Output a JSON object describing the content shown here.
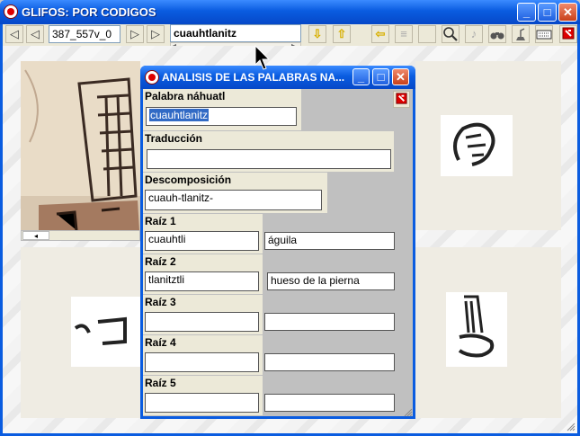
{
  "main_window": {
    "title": "GLIFOS: POR CODIGOS",
    "minimize": "_",
    "maximize": "□",
    "close": "✕"
  },
  "toolbar": {
    "code_field": "387_557v_0",
    "search_field": "cuauhtlanitz",
    "scroll_left": "◂",
    "scroll_right": "▸",
    "down_arrow": "⇩",
    "up_arrow": "⇧",
    "back_arrow": "⇦"
  },
  "panel_scroll_left": "◂",
  "dialog": {
    "title": "ANALISIS DE LAS PALABRAS NA...",
    "minimize": "_",
    "maximize": "□",
    "close": "✕",
    "palabra_label": "Palabra náhuatl",
    "palabra_value": "cuauhtlanitz",
    "traduccion_label": "Traducción",
    "traduccion_value": "",
    "descomposicion_label": "Descomposición",
    "descomposicion_value": "cuauh-tlanitz-",
    "roots": [
      {
        "label": "Raíz 1",
        "root": "cuauhtli",
        "meaning": "águila"
      },
      {
        "label": "Raíz 2",
        "root": "tlanitztli",
        "meaning": "hueso de la pierna"
      },
      {
        "label": "Raíz 3",
        "root": "",
        "meaning": ""
      },
      {
        "label": "Raíz 4",
        "root": "",
        "meaning": ""
      },
      {
        "label": "Raíz 5",
        "root": "",
        "meaning": ""
      }
    ]
  }
}
